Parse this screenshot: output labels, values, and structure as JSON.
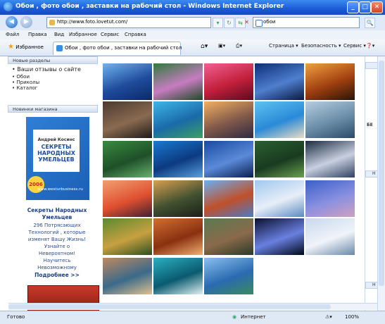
{
  "window": {
    "title": "Обои , фото обои , заставки на рабочий стол - Windows Internet Explorer"
  },
  "address": {
    "url": "http://www.foto.lovetut.com/",
    "search_query": "обои"
  },
  "menu": [
    "Файл",
    "Правка",
    "Вид",
    "Избранное",
    "Сервис",
    "Справка"
  ],
  "favorites_label": "Избранное",
  "tab_title": "Обои , фото обои , заставки на рабочий стол",
  "toolbar": {
    "page": "Страница ▾",
    "security": "Безопасность ▾",
    "service": "Сервис ▾",
    "help": "❓▾"
  },
  "left": {
    "new_sections": "Новые разделы",
    "reviews": "Ваши отзывы о сайте",
    "links": [
      "Обои",
      "Приколы",
      "Каталог"
    ],
    "shop_news": "Новинки магазина",
    "book": {
      "author": "Андрей Косинс",
      "l1": "СЕКРЕТЫ",
      "l2": "НАРОДНЫХ",
      "l3": "УМЕЛЬЦЕВ",
      "year": "2006",
      "site": "www.westurbusiness.ru"
    },
    "promo": {
      "title1": "Секреты Народных",
      "title2": "Умельцев",
      "l1": "296 Потрясающих",
      "l2": "Технологий , которые",
      "l3": "изменят Вашу Жизнь!",
      "l4": "Узнайте о",
      "l5": "Невероятном!",
      "l6": "Научитесь",
      "l7": "Невозможному",
      "more": "Подробнее >>"
    }
  },
  "right_labels": {
    "r1": "БЕ",
    "r2": "Н",
    "r3": "Н"
  },
  "status": {
    "ready": "Готово",
    "zone": "Интернет",
    "zoom": "100%"
  },
  "thumbnails": [
    {
      "name": "blue-mountains",
      "colors": [
        "#6fb3ef",
        "#1f4b9c",
        "#0b2a66"
      ]
    },
    {
      "name": "lotus-flowers",
      "colors": [
        "#2f7a3b",
        "#c77cc1",
        "#1d4a25"
      ]
    },
    {
      "name": "pink-sunset",
      "colors": [
        "#f06090",
        "#c21f3a",
        "#5c0b20"
      ]
    },
    {
      "name": "blue-night-lake",
      "colors": [
        "#0c2d78",
        "#4e7fcf",
        "#0a1940"
      ]
    },
    {
      "name": "orange-sunset-sea",
      "colors": [
        "#f0a040",
        "#a04010",
        "#2a1408"
      ]
    },
    {
      "name": "tree-roots",
      "colors": [
        "#4a3a30",
        "#8a6a50",
        "#1e1a18"
      ]
    },
    {
      "name": "tropical-lagoon",
      "colors": [
        "#3fb6e8",
        "#1a6aa8",
        "#3aa060"
      ]
    },
    {
      "name": "sunset-beach",
      "colors": [
        "#f2b060",
        "#80584a",
        "#2e2a40"
      ]
    },
    {
      "name": "palm-beach",
      "colors": [
        "#5ec2f0",
        "#2a8ad8",
        "#e8dcc0"
      ]
    },
    {
      "name": "grey-coast",
      "colors": [
        "#b7cde0",
        "#6a8da8",
        "#2a4a68"
      ]
    },
    {
      "name": "green-forest-lake",
      "colors": [
        "#3a8a40",
        "#1e5028",
        "#6ab070"
      ]
    },
    {
      "name": "island-sea",
      "colors": [
        "#1a7ad0",
        "#0c3a80",
        "#5aa0e0"
      ]
    },
    {
      "name": "blue-mountain-lake",
      "colors": [
        "#1a4aa0",
        "#5a8ad8",
        "#0a1e50"
      ]
    },
    {
      "name": "waterfall-jungle",
      "colors": [
        "#2a6030",
        "#1a3a20",
        "#6aa050"
      ]
    },
    {
      "name": "storm-sky",
      "colors": [
        "#1a2a40",
        "#c8d0e0",
        "#304060"
      ]
    },
    {
      "name": "red-sunset-clouds",
      "colors": [
        "#f0a070",
        "#e05030",
        "#402030"
      ]
    },
    {
      "name": "forest-waterfall",
      "colors": [
        "#d8a050",
        "#405030",
        "#1a2018"
      ]
    },
    {
      "name": "stone-arch",
      "colors": [
        "#6ab0f0",
        "#c0502a",
        "#4a7ac8"
      ]
    },
    {
      "name": "snowy-peaks",
      "colors": [
        "#a0c8f0",
        "#e8eef8",
        "#5a8ac0"
      ]
    },
    {
      "name": "purple-horizon",
      "colors": [
        "#3a60c8",
        "#8a90e0",
        "#d0a0c0"
      ]
    },
    {
      "name": "autumn-lake",
      "colors": [
        "#5a8a30",
        "#c8a040",
        "#2a5020"
      ]
    },
    {
      "name": "canyon-river",
      "colors": [
        "#d07030",
        "#8a3010",
        "#f0b070"
      ]
    },
    {
      "name": "big-trees",
      "colors": [
        "#5a7a50",
        "#8a6a4a",
        "#2a3a28"
      ]
    },
    {
      "name": "lightning",
      "colors": [
        "#0a1030",
        "#6a80e0",
        "#000818"
      ]
    },
    {
      "name": "snowy-forest",
      "colors": [
        "#c8d8ec",
        "#f0f4fa",
        "#6a88a8"
      ]
    },
    {
      "name": "coast-rocks",
      "colors": [
        "#c08860",
        "#3a6a8a",
        "#e0c090"
      ]
    },
    {
      "name": "ocean-wave",
      "colors": [
        "#2ab0c0",
        "#0a5a70",
        "#e0f0f0"
      ]
    },
    {
      "name": "blue-bay",
      "colors": [
        "#8ac0f0",
        "#2a6ab0",
        "#3a8a60"
      ]
    }
  ]
}
